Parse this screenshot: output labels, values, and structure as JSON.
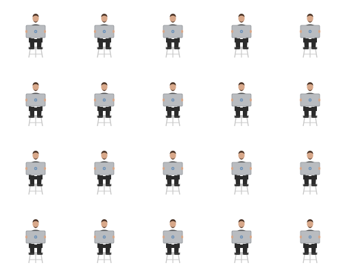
{
  "scene": {
    "rows": 4,
    "columns": 5,
    "figure": "person-sitting-on-stool-with-laptop-icon",
    "figure_variant": "person-with-laptop",
    "colors": {
      "background": "#ffffff",
      "skin": "#d8a88a",
      "hair": "#4a3326",
      "shirt": "#2f2f2f",
      "pants": "#2b2b2b",
      "laptop": "#b9bcc0",
      "laptop_edge": "#8f9296",
      "logo": "#4a7fb6",
      "stool": "#c8c8c8",
      "shoe": "#3a3a3a"
    }
  }
}
